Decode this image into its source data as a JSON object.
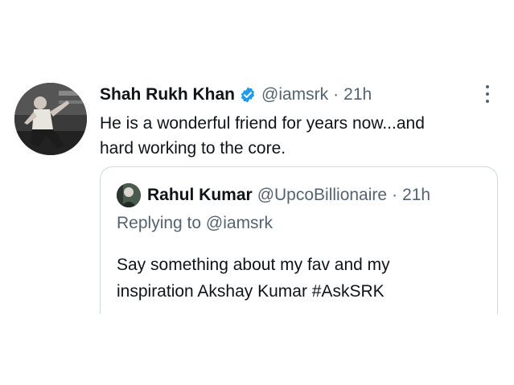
{
  "tweet": {
    "author_name": "Shah Rukh Khan",
    "handle": "@iamsrk",
    "separator": "·",
    "time": "21h",
    "line1": "He is a wonderful friend for years now...and",
    "line2": "hard working to the core.",
    "verified_color": "#1d9bf0",
    "avatar_icon": "profile-photo",
    "more_icon": "more-vertical-icon"
  },
  "quoted_tweet": {
    "author_name": "Rahul Kumar",
    "handle": "@UpcoBillionaire",
    "separator": "·",
    "time": "21h",
    "replying_prefix": "Replying to",
    "replying_handle": "@iamsrk",
    "line1": "Say something about my fav and my",
    "line2": "inspiration Akshay Kumar #AskSRK"
  }
}
